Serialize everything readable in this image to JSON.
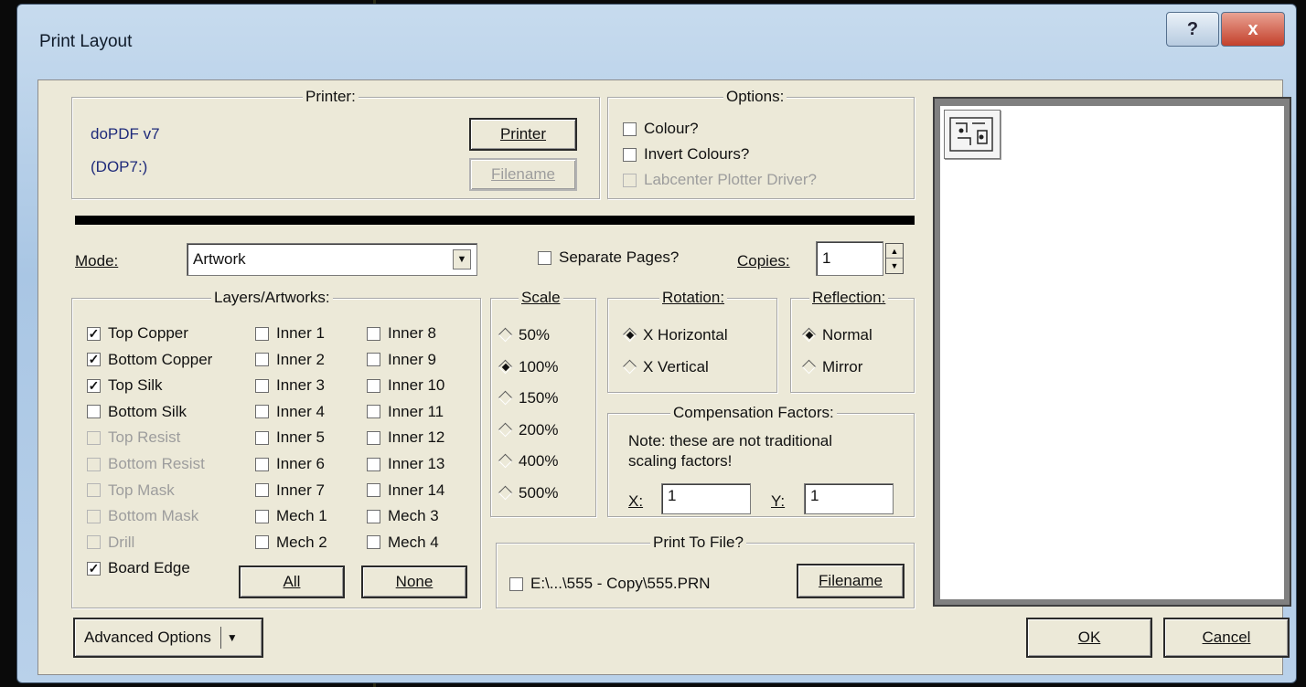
{
  "window": {
    "title": "Print Layout",
    "help_symbol": "?",
    "close_symbol": "x"
  },
  "printer": {
    "legend": "Printer:",
    "name": "doPDF v7",
    "port": "(DOP7:)",
    "printer_button": "Printer",
    "filename_button": "Filename"
  },
  "options": {
    "legend": "Options:",
    "colour": {
      "label": "Colour?",
      "checked": false
    },
    "invert": {
      "label": "Invert Colours?",
      "checked": false
    },
    "plotter": {
      "label": "Labcenter Plotter Driver?",
      "checked": false,
      "disabled": true
    }
  },
  "mode": {
    "label": "Mode:",
    "value": "Artwork"
  },
  "separate_pages": {
    "label": "Separate Pages?",
    "checked": false
  },
  "copies": {
    "label": "Copies:",
    "value": "1"
  },
  "layers": {
    "legend": "Layers/Artworks:",
    "col1": [
      {
        "label": "Top Copper",
        "checked": true,
        "disabled": false
      },
      {
        "label": "Bottom Copper",
        "checked": true,
        "disabled": false
      },
      {
        "label": "Top Silk",
        "checked": true,
        "disabled": false
      },
      {
        "label": "Bottom Silk",
        "checked": false,
        "disabled": false
      },
      {
        "label": "Top Resist",
        "checked": false,
        "disabled": true
      },
      {
        "label": "Bottom Resist",
        "checked": false,
        "disabled": true
      },
      {
        "label": "Top Mask",
        "checked": false,
        "disabled": true
      },
      {
        "label": "Bottom Mask",
        "checked": false,
        "disabled": true
      },
      {
        "label": "Drill",
        "checked": false,
        "disabled": true
      },
      {
        "label": "Board Edge",
        "checked": true,
        "disabled": false
      }
    ],
    "col2": [
      "Inner 1",
      "Inner 2",
      "Inner 3",
      "Inner 4",
      "Inner 5",
      "Inner 6",
      "Inner 7",
      "Mech 1",
      "Mech 2"
    ],
    "col3": [
      "Inner 8",
      "Inner 9",
      "Inner 10",
      "Inner 11",
      "Inner 12",
      "Inner 13",
      "Inner 14",
      "Mech 3",
      "Mech 4"
    ],
    "all_button": "All",
    "none_button": "None"
  },
  "scale": {
    "legend": "Scale",
    "options": [
      "50%",
      "100%",
      "150%",
      "200%",
      "400%",
      "500%"
    ],
    "selected": "100%"
  },
  "rotation": {
    "legend": "Rotation:",
    "options": [
      "X Horizontal",
      "X Vertical"
    ],
    "selected": "X Horizontal"
  },
  "reflection": {
    "legend": "Reflection:",
    "options": [
      "Normal",
      "Mirror"
    ],
    "selected": "Normal"
  },
  "compensation": {
    "legend": "Compensation Factors:",
    "note_line1": "Note: these are not traditional",
    "note_line2": "scaling factors!",
    "x_label": "X:",
    "x_value": "1",
    "y_label": "Y:",
    "y_value": "1"
  },
  "print_to_file": {
    "legend": "Print To File?",
    "path": "E:\\...\\555 - Copy\\555.PRN",
    "checked": false,
    "filename_button": "Filename"
  },
  "footer": {
    "advanced_button": "Advanced Options",
    "ok_button": "OK",
    "cancel_button": "Cancel"
  }
}
